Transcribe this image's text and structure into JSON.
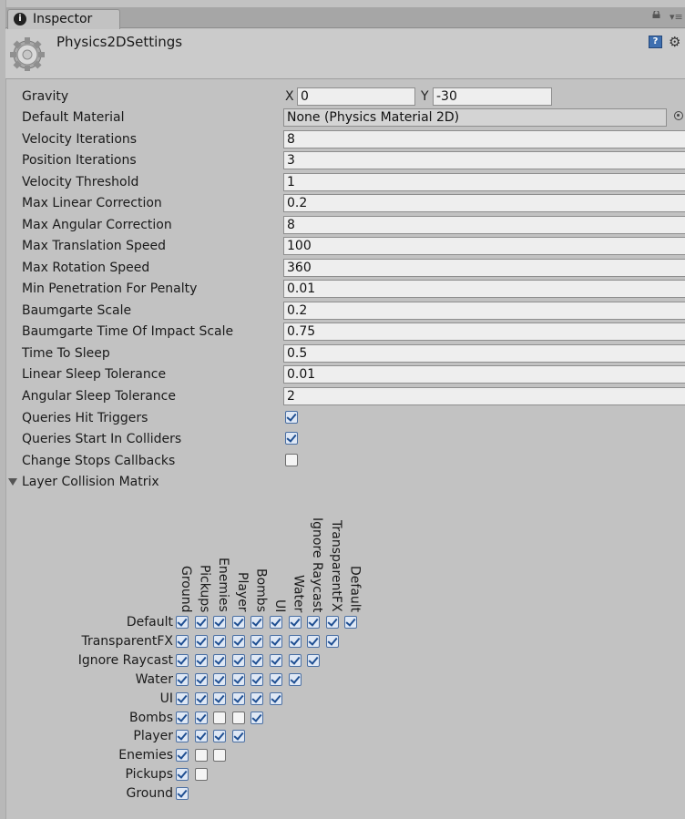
{
  "window": {
    "tab_label": "Inspector",
    "tab_icon_glyph": "i",
    "object_title": "Physics2DSettings"
  },
  "settings": {
    "gravity": {
      "label": "Gravity",
      "x_axis": "X",
      "x_value": "0",
      "y_axis": "Y",
      "y_value": "-30"
    },
    "default_material": {
      "label": "Default Material",
      "value": "None (Physics Material 2D)"
    },
    "fields": [
      {
        "label": "Velocity Iterations",
        "value": "8"
      },
      {
        "label": "Position Iterations",
        "value": "3"
      },
      {
        "label": "Velocity Threshold",
        "value": "1"
      },
      {
        "label": "Max Linear Correction",
        "value": "0.2"
      },
      {
        "label": "Max Angular Correction",
        "value": "8"
      },
      {
        "label": "Max Translation Speed",
        "value": "100"
      },
      {
        "label": "Max Rotation Speed",
        "value": "360"
      },
      {
        "label": "Min Penetration For Penalty",
        "value": "0.01"
      },
      {
        "label": "Baumgarte Scale",
        "value": "0.2"
      },
      {
        "label": "Baumgarte Time Of Impact Scale",
        "value": "0.75"
      },
      {
        "label": "Time To Sleep",
        "value": "0.5"
      },
      {
        "label": "Linear Sleep Tolerance",
        "value": "0.01"
      },
      {
        "label": "Angular Sleep Tolerance",
        "value": "2"
      }
    ],
    "toggles": [
      {
        "label": "Queries Hit Triggers",
        "checked": true
      },
      {
        "label": "Queries Start In Colliders",
        "checked": true
      },
      {
        "label": "Change Stops Callbacks",
        "checked": false
      }
    ]
  },
  "layer_collision_matrix": {
    "label": "Layer Collision Matrix",
    "columns": [
      "Ground",
      "Pickups",
      "Enemies",
      "Player",
      "Bombs",
      "UI",
      "Water",
      "Ignore Raycast",
      "TransparentFX",
      "Default"
    ],
    "rows": [
      {
        "label": "Default",
        "cells": [
          true,
          true,
          true,
          true,
          true,
          true,
          true,
          true,
          true,
          true
        ]
      },
      {
        "label": "TransparentFX",
        "cells": [
          true,
          true,
          true,
          true,
          true,
          true,
          true,
          true,
          true
        ]
      },
      {
        "label": "Ignore Raycast",
        "cells": [
          true,
          true,
          true,
          true,
          true,
          true,
          true,
          true
        ]
      },
      {
        "label": "Water",
        "cells": [
          true,
          true,
          true,
          true,
          true,
          true,
          true
        ]
      },
      {
        "label": "UI",
        "cells": [
          true,
          true,
          true,
          true,
          true,
          true
        ]
      },
      {
        "label": "Bombs",
        "cells": [
          true,
          true,
          false,
          false,
          true
        ]
      },
      {
        "label": "Player",
        "cells": [
          true,
          true,
          true,
          true
        ]
      },
      {
        "label": "Enemies",
        "cells": [
          true,
          false,
          false
        ]
      },
      {
        "label": "Pickups",
        "cells": [
          true,
          false
        ]
      },
      {
        "label": "Ground",
        "cells": [
          true
        ]
      }
    ]
  },
  "icons": {
    "tab": "info-icon",
    "lock": "lock-icon",
    "menu": "context-menu-icon",
    "asset": "settings-asset-icon",
    "help": "help-book-icon",
    "gear": "gear-icon",
    "picker": "object-picker-icon",
    "foldout": "foldout-arrow-icon"
  },
  "colors": {
    "background": "#c2c2c2",
    "checkbox_check": "#1f4f92"
  }
}
